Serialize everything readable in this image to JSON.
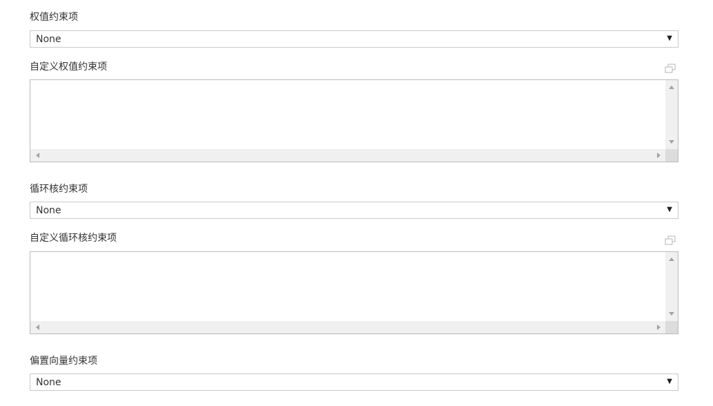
{
  "fields": [
    {
      "label": "权值约束项",
      "select_value": "None"
    },
    {
      "label": "自定义权值约束项",
      "textarea_value": ""
    },
    {
      "label": "循环核约束项",
      "select_value": "None"
    },
    {
      "label": "自定义循环核约束项",
      "textarea_value": ""
    },
    {
      "label": "偏置向量约束项",
      "select_value": "None"
    }
  ],
  "icons": {
    "select_arrow": "dropdown-arrow-icon",
    "popout": "popout-window-icon",
    "arrow_glyph": "▼"
  }
}
